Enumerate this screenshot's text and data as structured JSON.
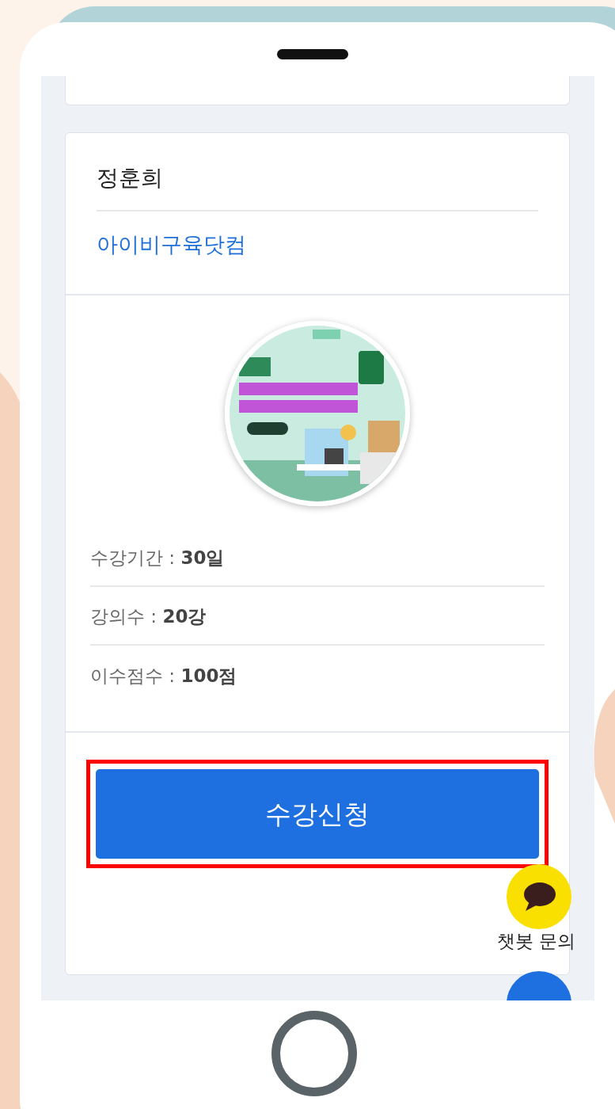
{
  "instructor": {
    "name": "정훈희",
    "link": "아이비구육닷컴"
  },
  "course": {
    "details": [
      "수강기간 : **30일**",
      "강의수 : **20강**",
      "이수점수 : **100점**"
    ]
  },
  "enroll_button": {
    "label": "수강신청",
    "highlighted": true
  },
  "chatbot": {
    "label": "챗봇 문의"
  }
}
